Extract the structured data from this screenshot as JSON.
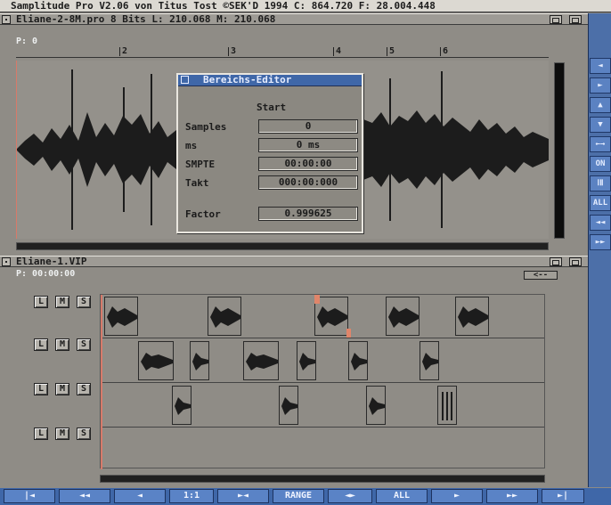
{
  "app": {
    "screen_title": "Samplitude Pro V2.06 von Titus Tost ©SEK'D 1994   C: 864.720 F: 28.004.448"
  },
  "window1": {
    "title": "Eliane-2-8M.pro   8 Bits L: 210.068 M: 210.068",
    "position": "P: 0",
    "markers": [
      "2",
      "3",
      "4",
      "5",
      "6"
    ]
  },
  "dialog": {
    "title": "Bereichs-Editor",
    "header": "Start",
    "fields": [
      {
        "label": "Samples",
        "value": "0"
      },
      {
        "label": "ms",
        "value": "0 ms"
      },
      {
        "label": "SMPTE",
        "value": "00:00:00"
      },
      {
        "label": "Takt",
        "value": "000:00:000"
      },
      {
        "label": "Factor",
        "value": "0.999625"
      }
    ]
  },
  "window2": {
    "title": "Eliane-1.VIP",
    "position": "P: 00:00:00",
    "track_buttons": [
      "L",
      "M",
      "S"
    ]
  },
  "sidebar": {
    "buttons": [
      "◄",
      "►",
      "▲",
      "▼",
      "←→",
      "ON",
      "ⅠⅡ",
      "ALL",
      "◄◄",
      "►►"
    ]
  },
  "toolbar": {
    "buttons": [
      "|◄",
      "◄◄",
      "◄",
      "1:1",
      "►◄",
      "RANGE",
      "◄►",
      "ALL",
      "►",
      "►►",
      "►|"
    ]
  },
  "colors": {
    "toolbar": "#3f67a8",
    "background": "#8f8c86",
    "waveform": "#1c1c1c",
    "marker": "#e0856a"
  }
}
